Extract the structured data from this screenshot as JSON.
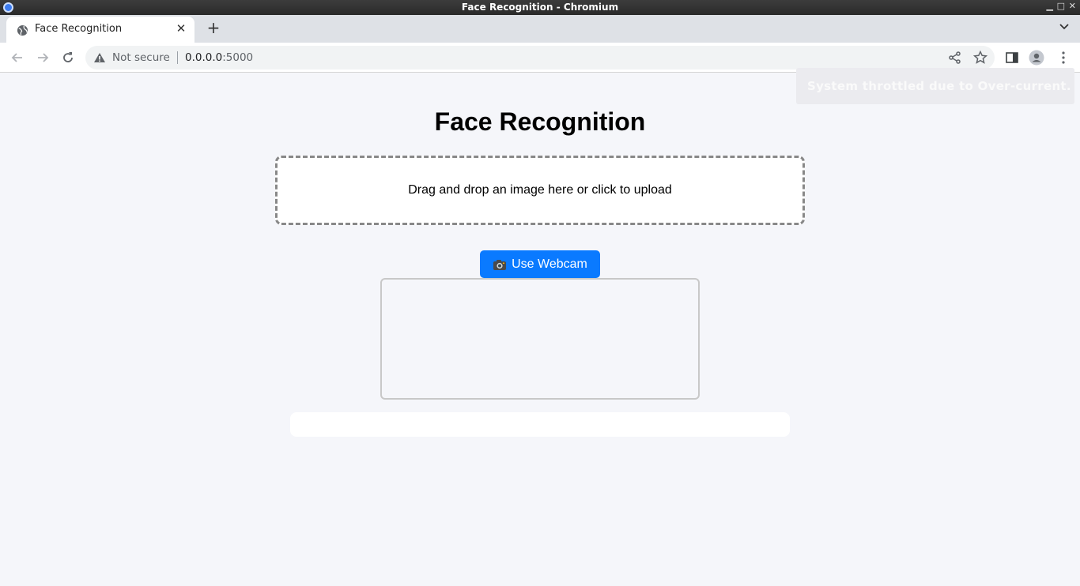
{
  "window": {
    "title": "Face Recognition - Chromium"
  },
  "browser": {
    "tab_title": "Face Recognition",
    "security_label": "Not secure",
    "url_host": "0.0.0.0",
    "url_port": ":5000"
  },
  "notification": {
    "text": "System throttled due to Over-current."
  },
  "page": {
    "title": "Face Recognition",
    "dropzone_text": "Drag and drop an image here or click to upload",
    "webcam_button_label": "Use Webcam"
  },
  "colors": {
    "accent": "#0a7aff",
    "background": "#f5f6fa"
  },
  "icons": [
    "globe-icon",
    "close-icon",
    "plus-icon",
    "back-icon",
    "forward-icon",
    "reload-icon",
    "warning-icon",
    "share-icon",
    "star-icon",
    "sidepanel-icon",
    "profile-icon",
    "menu-icon",
    "camera-icon"
  ]
}
